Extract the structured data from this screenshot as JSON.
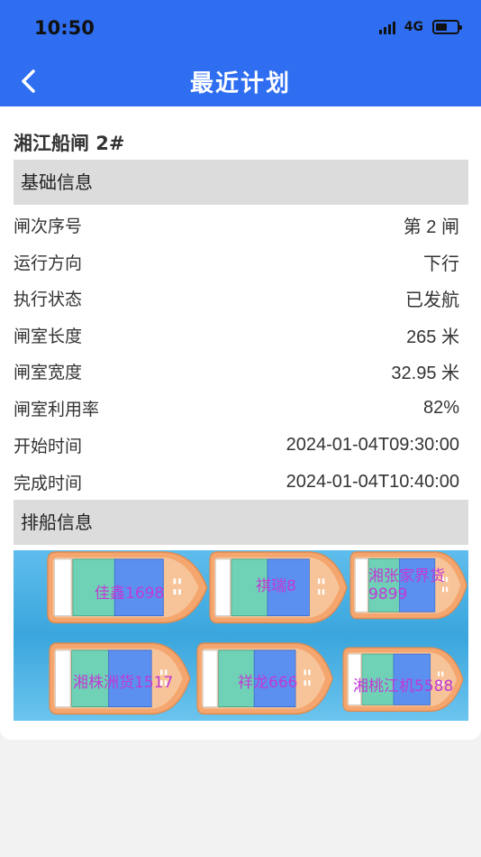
{
  "status_bar": {
    "time": "10:50",
    "network": "4G"
  },
  "nav": {
    "title": "最近计划",
    "back_icon": "chevron-left-icon"
  },
  "lock_name": "湘江船闸 2#",
  "sections": {
    "basic_info": "基础信息",
    "ship_arrangement": "排船信息"
  },
  "info_rows": [
    {
      "label": "闸次序号",
      "value": "第 2 闸"
    },
    {
      "label": "运行方向",
      "value": "下行"
    },
    {
      "label": "执行状态",
      "value": "已发航"
    },
    {
      "label": "闸室长度",
      "value": "265 米"
    },
    {
      "label": "闸室宽度",
      "value": "32.95 米"
    },
    {
      "label": "闸室利用率",
      "value": "82%"
    },
    {
      "label": "开始时间",
      "value": "2024-01-04T09:30:00"
    },
    {
      "label": "完成时间",
      "value": "2024-01-04T10:40:00"
    }
  ],
  "ships": [
    {
      "name": "佳鑫1698"
    },
    {
      "name": "祺瑞8"
    },
    {
      "name": "湘张家界货9899"
    },
    {
      "name": "湘株洲货1517"
    },
    {
      "name": "祥龙666"
    },
    {
      "name": "湘桃江机5588"
    }
  ],
  "colors": {
    "header": "#2f6ef0",
    "section_bg": "#dcdcdc",
    "ship_label": "#c13ad6",
    "ship_hull": "#f4a66e",
    "ship_cargo_teal": "#6fd1b6",
    "ship_cargo_blue": "#5b8ff0",
    "water": "#3aa6dd"
  }
}
